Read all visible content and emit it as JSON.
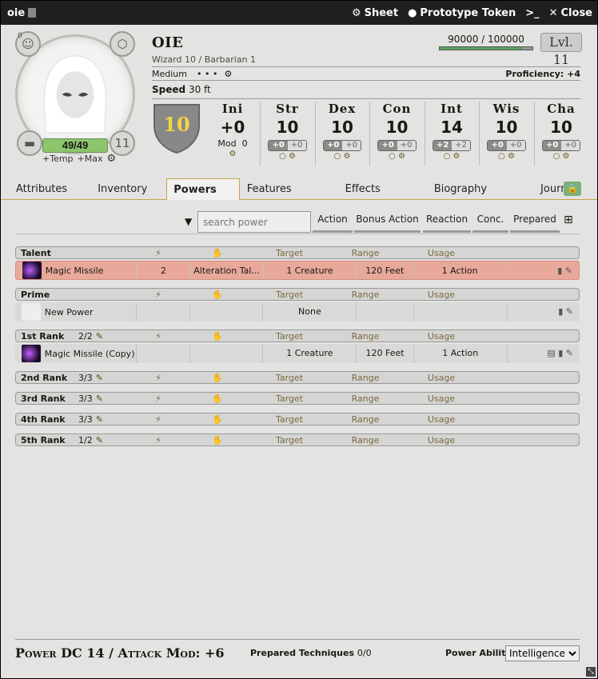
{
  "window": {
    "title": "oie",
    "sheet_label": "Sheet",
    "token_label": "Prototype Token",
    "close_label": "Close"
  },
  "character": {
    "name": "OIE",
    "classes": "Wizard 10 / Barbarian 1",
    "size": "Medium",
    "dots": "• • •",
    "proficiency": "Proficiency: +4",
    "speed_label": "Speed",
    "speed_value": "30 ft",
    "xp_current": "90000",
    "xp_max": "100000",
    "xp_text": "90000 / 100000",
    "xp_fraction": 0.9,
    "level": "Lvl. 11",
    "hp": "49/49",
    "hit_dice": "11",
    "inspiration": "0",
    "temp_label": "+Temp",
    "max_label": "+Max",
    "ac": "10",
    "initiative": {
      "label": "Ini",
      "value": "+0",
      "mod_label": "Mod",
      "mod_value": "0"
    },
    "abilities": [
      {
        "label": "Str",
        "value": "10",
        "mod": "+0",
        "save": "+0"
      },
      {
        "label": "Dex",
        "value": "10",
        "mod": "+0",
        "save": "+0"
      },
      {
        "label": "Con",
        "value": "10",
        "mod": "+0",
        "save": "+0"
      },
      {
        "label": "Int",
        "value": "14",
        "mod": "+2",
        "save": "+2"
      },
      {
        "label": "Wis",
        "value": "10",
        "mod": "+0",
        "save": "+0"
      },
      {
        "label": "Cha",
        "value": "10",
        "mod": "+0",
        "save": "+0"
      }
    ]
  },
  "tabs": [
    "Attributes",
    "Inventory",
    "Powers",
    "Features",
    "Effects",
    "Biography",
    "Journal"
  ],
  "active_tab": "Powers",
  "filters": {
    "search_placeholder": "search power",
    "buttons": [
      "Action",
      "Bonus Action",
      "Reaction",
      "Conc.",
      "Prepared"
    ]
  },
  "columns": {
    "target": "Target",
    "range": "Range",
    "usage": "Usage"
  },
  "groups": [
    {
      "name": "Talent",
      "uses": "",
      "rows": [
        {
          "name": "Magic Missile",
          "count": "2",
          "school": "Alteration Tal...",
          "target": "1 Creature",
          "range": "120 Feet",
          "usage": "1 Action"
        }
      ]
    },
    {
      "name": "Prime",
      "uses": "",
      "rows": [
        {
          "name": "New Power",
          "count": "",
          "school": "",
          "target": "None",
          "range": "",
          "usage": ""
        }
      ]
    },
    {
      "name": "1st Rank",
      "uses": "2/2",
      "rows": [
        {
          "name": "Magic Missile (Copy)",
          "count": "",
          "school": "",
          "target": "1 Creature",
          "range": "120 Feet",
          "usage": "1 Action"
        }
      ]
    },
    {
      "name": "2nd Rank",
      "uses": "3/3",
      "rows": []
    },
    {
      "name": "3rd Rank",
      "uses": "3/3",
      "rows": []
    },
    {
      "name": "4th Rank",
      "uses": "3/3",
      "rows": []
    },
    {
      "name": "5th Rank",
      "uses": "1/2",
      "rows": []
    }
  ],
  "footer": {
    "dc_text": "Power DC 14 / Attack Mod: +6",
    "prepared_label": "Prepared Techniques",
    "prepared_value": "0/0",
    "ability_label": "Power Ability",
    "ability_value": "Intelligence"
  }
}
